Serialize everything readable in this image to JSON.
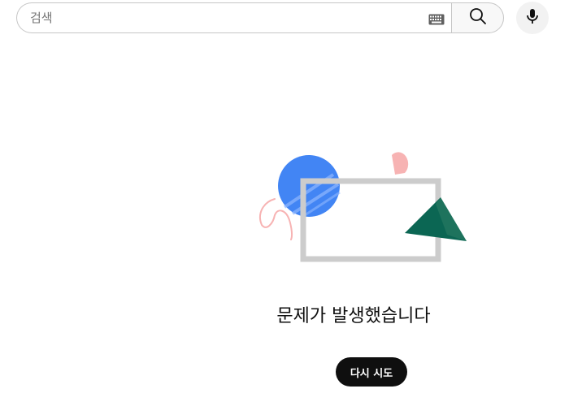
{
  "search": {
    "placeholder": "검색",
    "value": "",
    "keyboard_icon": "keyboard-icon",
    "search_icon": "search-icon",
    "mic_icon": "microphone-icon"
  },
  "error": {
    "message": "문제가 발생했습니다",
    "retry_label": "다시 시도",
    "illustration_icon": "error-illustration",
    "colors": {
      "circle": "#4285f4",
      "triangle": "#0b6653",
      "frame": "#cccccc",
      "pink": "#f7b3b3"
    }
  },
  "colors": {
    "button_bg": "#0f0f0f",
    "button_text": "#ffffff",
    "border": "#c6c6c6"
  }
}
